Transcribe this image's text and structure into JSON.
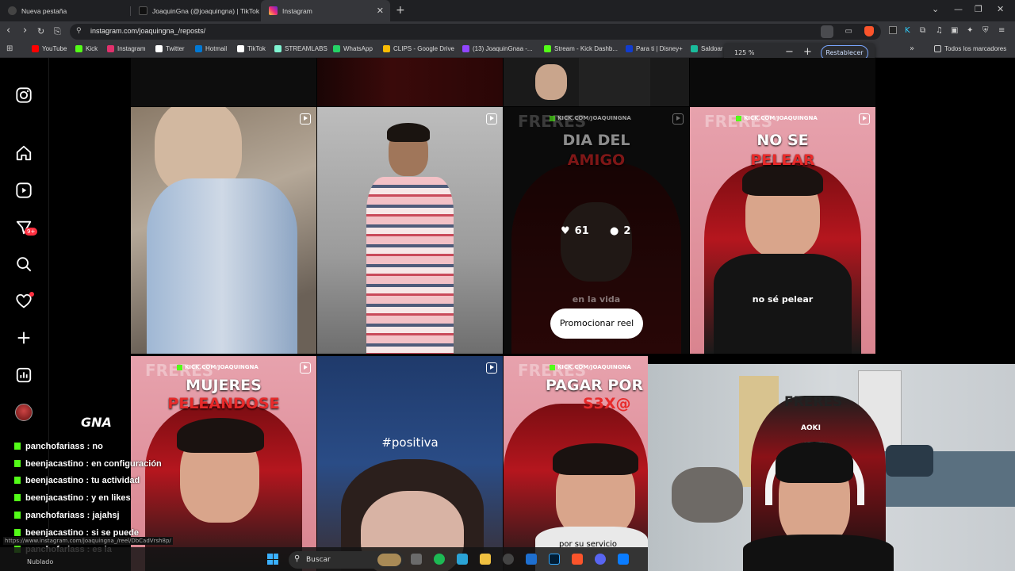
{
  "tabs": [
    {
      "title": "Nueva pestaña",
      "active": false
    },
    {
      "title": "JoaquinGna (@joaquingna) | TikTok",
      "active": false
    },
    {
      "title": "Instagram",
      "active": true
    }
  ],
  "address": {
    "url": "instagram.com/joaquingna_/reposts/"
  },
  "bookmarks": [
    {
      "label": "YouTube",
      "color": "#ff0000"
    },
    {
      "label": "Kick",
      "color": "#53fc18"
    },
    {
      "label": "Instagram",
      "color": "#e1306c"
    },
    {
      "label": "Twitter",
      "color": "#ffffff"
    },
    {
      "label": "Hotmail",
      "color": "#0078d4"
    },
    {
      "label": "TikTok",
      "color": "#ffffff"
    },
    {
      "label": "STREAMLABS",
      "color": "#80f5d2"
    },
    {
      "label": "WhatsApp",
      "color": "#25d366"
    },
    {
      "label": "CLIPS - Google Drive",
      "color": "#fbbc04"
    },
    {
      "label": "(13) JoaquinGnaa -...",
      "color": "#9146ff"
    },
    {
      "label": "Stream - Kick Dashb...",
      "color": "#53fc18"
    },
    {
      "label": "Para ti | Disney+",
      "color": "#113ccf"
    },
    {
      "label": "Saldoar",
      "color": "#1abc9c"
    }
  ],
  "bookmarks_all": "Todos los marcadores",
  "zoom": {
    "value": "125 %",
    "minus": "−",
    "plus": "+",
    "reset": "Restablecer"
  },
  "sidebar": {
    "notifications_badge": "9+"
  },
  "grid": {
    "tile3": {
      "kick": "KICK.COM/JOAQUINGNA",
      "title_line1": "DIA DEL",
      "title_line2": "AMIGO",
      "likes": "61",
      "comments": "2",
      "caption": "en la vida",
      "promote": "Promocionar reel"
    },
    "tile4": {
      "kick": "KICK.COM/JOAQUINGNA",
      "title_line1": "NO SE",
      "title_line2": "PELEAR",
      "caption": "no sé pelear"
    },
    "tile5": {
      "kick": "KICK.COM/JOAQUINGNA",
      "title_line1": "MUJERES",
      "title_line2": "PELEANDOSE"
    },
    "tile6": {
      "caption": "#positiva"
    },
    "tile7": {
      "kick": "KICK.COM/JOAQUINGNA",
      "title_line1": "PAGAR POR",
      "title_line2": "S3X@",
      "caption": "por su servicio"
    },
    "freres": "FRERES"
  },
  "chat": {
    "logo": "GNA",
    "messages": [
      {
        "user": "panchofariass",
        "text": " : no"
      },
      {
        "user": "beenjacastino",
        "text": " : en configuración"
      },
      {
        "user": "beenjacastino",
        "text": " : tu actividad"
      },
      {
        "user": "beenjacastino",
        "text": " : y en likes"
      },
      {
        "user": "panchofariass",
        "text": " : jajahsj"
      },
      {
        "user": "beenjacastino",
        "text": " : si se puede"
      },
      {
        "user": "panchofariass",
        "text": " : es ia"
      }
    ]
  },
  "status_url": "https://www.instagram.com/joaquingna_/reel/DbCadVrsh8p/",
  "webcam": {
    "freres": "FRERES",
    "chair": "AOKI"
  },
  "taskbar": {
    "search": "Buscar",
    "weather": "Nublado"
  }
}
